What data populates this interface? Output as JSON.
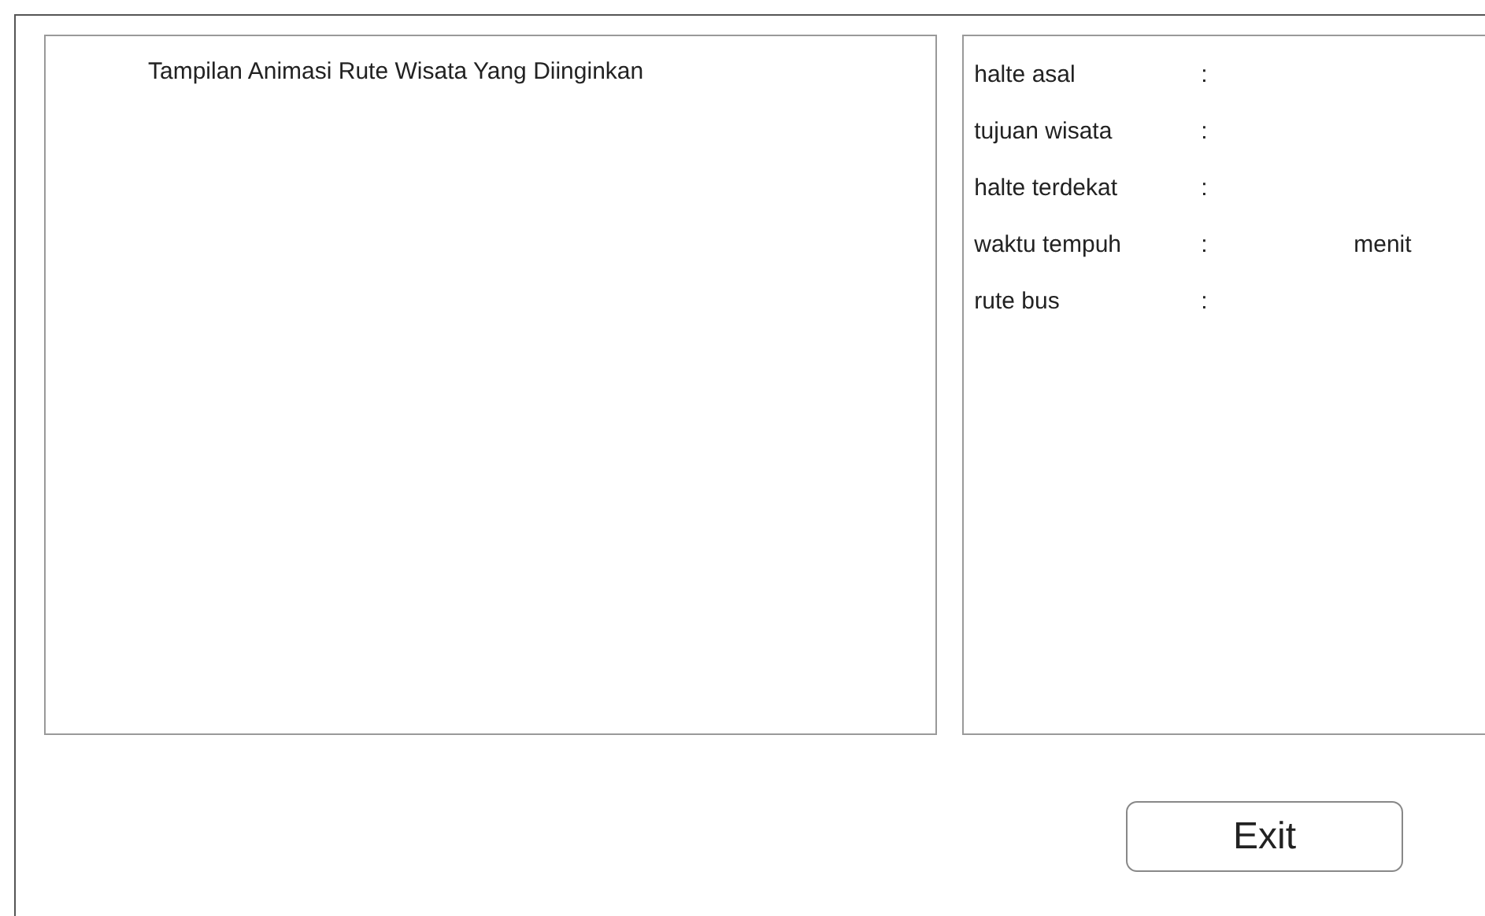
{
  "animation_panel": {
    "title": "Tampilan Animasi Rute Wisata Yang Diinginkan"
  },
  "info_fields": [
    {
      "label": "halte asal",
      "separator": ":"
    },
    {
      "label": "tujuan wisata",
      "separator": ":"
    },
    {
      "label": "halte terdekat",
      "separator": ":"
    },
    {
      "label": "waktu tempuh",
      "separator": ":",
      "unit": "menit"
    },
    {
      "label": "rute bus",
      "separator": ":"
    }
  ],
  "buttons": [
    {
      "label": "Exit"
    }
  ]
}
